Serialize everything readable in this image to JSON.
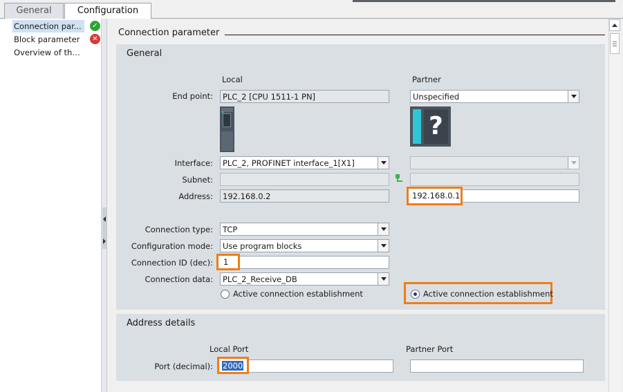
{
  "tabs": [
    {
      "label": "General",
      "active": false
    },
    {
      "label": "Configuration",
      "active": true
    }
  ],
  "nav": [
    {
      "label": "Connection par...",
      "status": "ok",
      "status_icon": "check-circle-icon",
      "selected": true
    },
    {
      "label": "Block parameter",
      "status": "error",
      "status_icon": "error-circle-icon",
      "selected": false
    },
    {
      "label": "Overview of the ...",
      "status": null,
      "selected": false
    }
  ],
  "main": {
    "title": "Connection parameter",
    "general": {
      "title": "General",
      "local_header": "Local",
      "partner_header": "Partner",
      "labels": {
        "end_point": "End point:",
        "interface": "Interface:",
        "subnet": "Subnet:",
        "address": "Address:",
        "connection_type": "Connection type:",
        "configuration_mode": "Configuration mode:",
        "connection_id": "Connection ID (dec):",
        "connection_data": "Connection data:"
      },
      "local": {
        "end_point": "PLC_2 [CPU 1511-1 PN]",
        "interface": "PLC_2, PROFINET interface_1[X1]",
        "subnet": "",
        "address": "192.168.0.2"
      },
      "partner": {
        "end_point": "Unspecified",
        "interface": "",
        "subnet": "",
        "address": "192.168.0.1"
      },
      "connection_type": "TCP",
      "configuration_mode": "Use program blocks",
      "connection_id": "1",
      "connection_data": "PLC_2_Receive_DB",
      "local_active_label": "Active connection establishment",
      "partner_active_label": "Active connection establishment",
      "partner_active_selected": true
    },
    "address_details": {
      "title": "Address details",
      "local_port_header": "Local Port",
      "partner_port_header": "Partner Port",
      "port_label": "Port (decimal):",
      "local_port": "2000",
      "partner_port": ""
    }
  },
  "colors": {
    "highlight": "#ef7d17",
    "section_bg": "#dadfe4",
    "selection_bg": "#2f6bbf",
    "ok": "#2fa335",
    "error": "#d63a3a"
  }
}
